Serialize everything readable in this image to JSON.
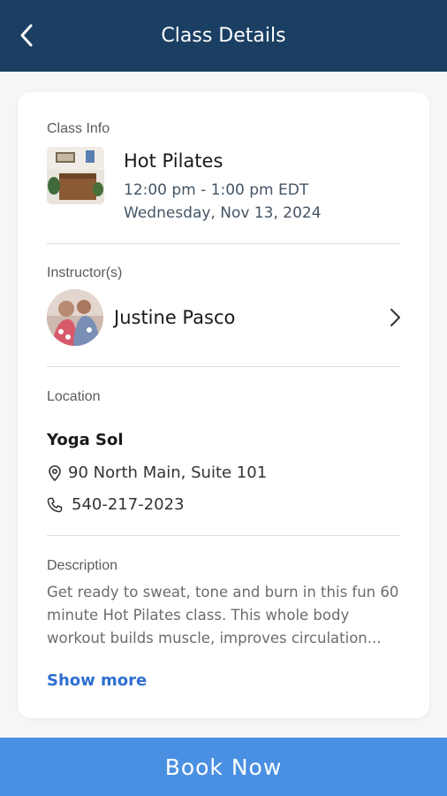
{
  "header": {
    "title": "Class Details",
    "back_icon": "chevron-left-icon"
  },
  "class_info": {
    "label": "Class Info",
    "name": "Hot Pilates",
    "time": "12:00 pm - 1:00 pm EDT",
    "date": "Wednesday, Nov 13, 2024"
  },
  "instructor": {
    "label": "Instructor(s)",
    "name": "Justine Pasco"
  },
  "location": {
    "label": "Location",
    "name": "Yoga Sol",
    "address": "90 North Main, Suite 101",
    "phone": "540-217-2023"
  },
  "description": {
    "label": "Description",
    "text": "Get ready to sweat, tone and burn in this fun 60 minute Hot Pilates class. This whole body workout builds muscle, improves circulation...",
    "show_more": "Show more"
  },
  "footer": {
    "book_label": "Book Now"
  },
  "colors": {
    "header_bg": "#1b3f63",
    "accent": "#4a90e2",
    "link": "#2f6fd0"
  }
}
